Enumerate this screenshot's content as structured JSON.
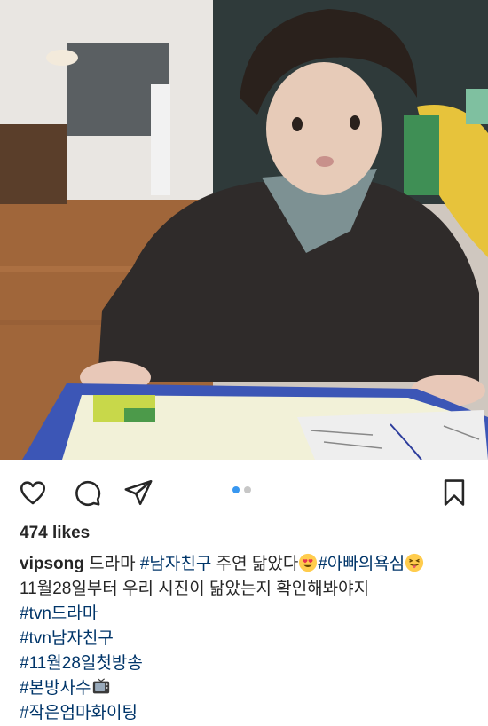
{
  "post": {
    "likes": "474 likes",
    "username": "vipsong",
    "caption_lines": [
      {
        "parts": [
          {
            "type": "text",
            "value": " 드라마 "
          },
          {
            "type": "tag",
            "value": "#남자친구"
          },
          {
            "type": "text",
            "value": " 주연 닮았다"
          },
          {
            "type": "emoji",
            "value": "heart-eyes-emoji"
          },
          {
            "type": "tag",
            "value": "#아빠의욕심"
          },
          {
            "type": "emoji",
            "value": "tongue-wink-emoji"
          }
        ]
      },
      {
        "text": "11월28일부터 우리 시진이 닮았는지 확인해봐야지"
      },
      {
        "tag": "#tvn드라마"
      },
      {
        "tag": "#tvn남자친구"
      },
      {
        "tag": "#11월28일첫방송"
      },
      {
        "tag": "#본방사수",
        "emoji": "tv-emoji"
      },
      {
        "tag": "#작은엄마화이팅"
      }
    ],
    "carousel": {
      "total": 2,
      "active": 1
    }
  },
  "icons": {
    "like": "heart-icon",
    "comment": "comment-icon",
    "share": "paper-plane-icon",
    "save": "bookmark-icon"
  },
  "colors": {
    "hashtag": "#003569",
    "active_dot": "#3897f0",
    "inactive_dot": "#c7c7c7",
    "text": "#262626"
  }
}
